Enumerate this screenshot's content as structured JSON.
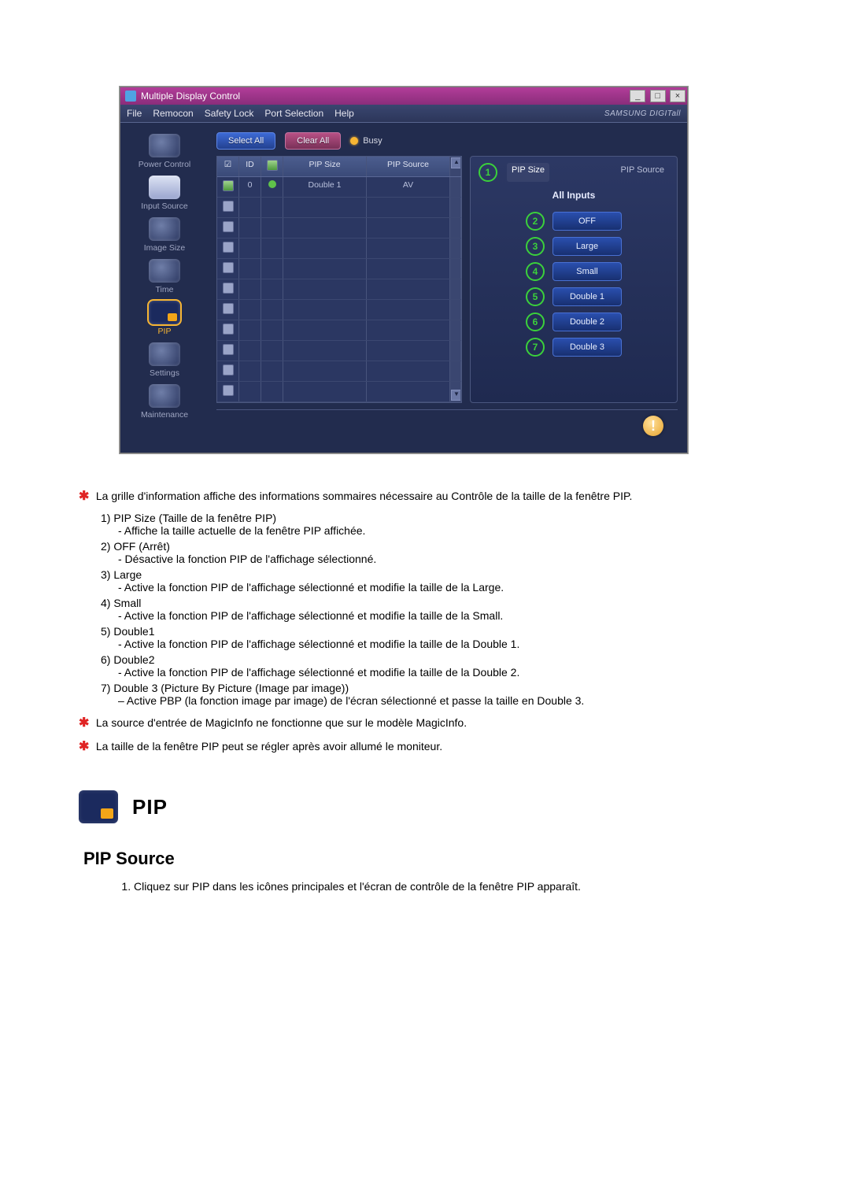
{
  "window": {
    "title": "Multiple Display Control",
    "brand": "SAMSUNG DIGITall"
  },
  "menubar": [
    "File",
    "Remocon",
    "Safety Lock",
    "Port Selection",
    "Help"
  ],
  "sidebar": {
    "items": [
      {
        "label": "Power Control"
      },
      {
        "label": "Input Source"
      },
      {
        "label": "Image Size"
      },
      {
        "label": "Time"
      },
      {
        "label": "PIP"
      },
      {
        "label": "Settings"
      },
      {
        "label": "Maintenance"
      }
    ]
  },
  "toolbar": {
    "select_all": "Select All",
    "clear_all": "Clear All",
    "busy": "Busy"
  },
  "grid": {
    "head": {
      "chk": "☑",
      "id": "ID",
      "status": "",
      "pip_size": "PIP Size",
      "pip_source": "PIP Source"
    },
    "rows": [
      {
        "checked": true,
        "id": "0",
        "status": "on",
        "pip_size": "Double 1",
        "pip_source": "AV"
      },
      {
        "checked": false
      },
      {
        "checked": false
      },
      {
        "checked": false
      },
      {
        "checked": false
      },
      {
        "checked": false
      },
      {
        "checked": false
      },
      {
        "checked": false
      },
      {
        "checked": false
      },
      {
        "checked": false
      },
      {
        "checked": false
      }
    ]
  },
  "panel": {
    "tabs": {
      "size": "PIP Size",
      "source": "PIP Source"
    },
    "subtitle": "All Inputs",
    "options": [
      {
        "n": "2",
        "label": "OFF"
      },
      {
        "n": "3",
        "label": "Large"
      },
      {
        "n": "4",
        "label": "Small"
      },
      {
        "n": "5",
        "label": "Double 1"
      },
      {
        "n": "6",
        "label": "Double 2"
      },
      {
        "n": "7",
        "label": "Double 3"
      }
    ],
    "callout1": "1"
  },
  "doc": {
    "intro": "La grille d'information affiche des informations sommaires nécessaire au Contrôle de la taille de la fenêtre PIP.",
    "items": [
      {
        "n": "1)",
        "label": "PIP Size (Taille de la fenêtre PIP)",
        "desc": "- Affiche la taille actuelle de la fenêtre PIP affichée."
      },
      {
        "n": "2)",
        "label": "OFF (Arrêt)",
        "desc": "- Désactive la fonction PIP de l'affichage sélectionné."
      },
      {
        "n": "3)",
        "label": "Large",
        "desc": "- Active la fonction PIP de l'affichage sélectionné et modifie la taille de la Large."
      },
      {
        "n": "4)",
        "label": "Small",
        "desc": "- Active la fonction PIP de l'affichage sélectionné et modifie la taille de la Small."
      },
      {
        "n": "5)",
        "label": "Double1",
        "desc": "- Active la fonction PIP de l'affichage sélectionné et modifie la taille de la Double 1."
      },
      {
        "n": "6)",
        "label": "Double2",
        "desc": "- Active la fonction PIP de l'affichage sélectionné et modifie la taille de la Double 2."
      },
      {
        "n": "7)",
        "label": "Double 3 (Picture By Picture (Image par image))",
        "desc": "– Active PBP (la fonction image par image) de l'écran sélectionné et passe la taille en Double 3."
      }
    ],
    "note1": "La source d'entrée de MagicInfo ne fonctionne que sur le modèle MagicInfo.",
    "note2": "La taille de la fenêtre PIP peut se régler après avoir allumé le moniteur.",
    "section_title": "PIP",
    "subhead": "PIP Source",
    "step1": "Cliquez sur PIP dans les icônes principales et l'écran de contrôle de la fenêtre PIP apparaît."
  }
}
